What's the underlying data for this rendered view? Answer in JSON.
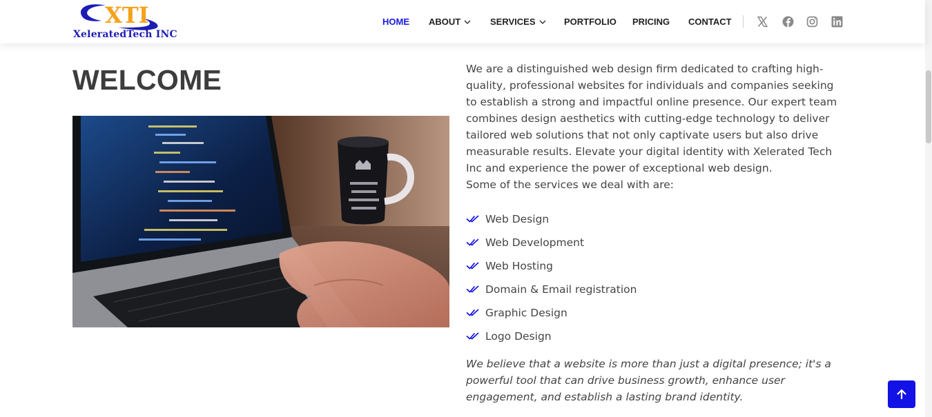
{
  "brand": {
    "logo_letters": "XTI",
    "logo_wordmark": "XeleratedTech INC",
    "colors": {
      "blue": "#1d1db5",
      "orange": "#f5a21b",
      "accent": "#1212e6"
    }
  },
  "nav": {
    "items": [
      {
        "label": "HOME",
        "active": true
      },
      {
        "label": "ABOUT",
        "dropdown": true
      },
      {
        "label": "SERVICES",
        "dropdown": true
      },
      {
        "label": "PORTFOLIO"
      },
      {
        "label": "PRICING"
      },
      {
        "label": "CONTACT"
      }
    ],
    "social": [
      "x-icon",
      "facebook-icon",
      "instagram-icon",
      "linkedin-icon"
    ]
  },
  "main": {
    "title": "WELCOME",
    "image_subject": "laptop-with-code-and-coffee-mug",
    "intro": "We are a distinguished web design firm dedicated to crafting high-quality, professional websites for individuals and companies seeking to establish a strong and impactful online presence. Our expert team combines design aesthetics with cutting-edge technology to deliver tailored web solutions that not only captivate users but also drive measurable results. Elevate your digital identity with Xelerated Tech Inc and experience the power of exceptional web design.",
    "services_intro": "Some of the services we deal with are:",
    "services": [
      "Web Design",
      "Web Development",
      "Web Hosting",
      "Domain & Email registration",
      "Graphic Design",
      "Logo Design"
    ],
    "closing": "We believe that a website is more than just a digital presence; it's a powerful tool that can drive business growth, enhance user engagement, and establish a lasting brand identity."
  },
  "back_to_top": {
    "icon": "arrow-up-icon"
  }
}
